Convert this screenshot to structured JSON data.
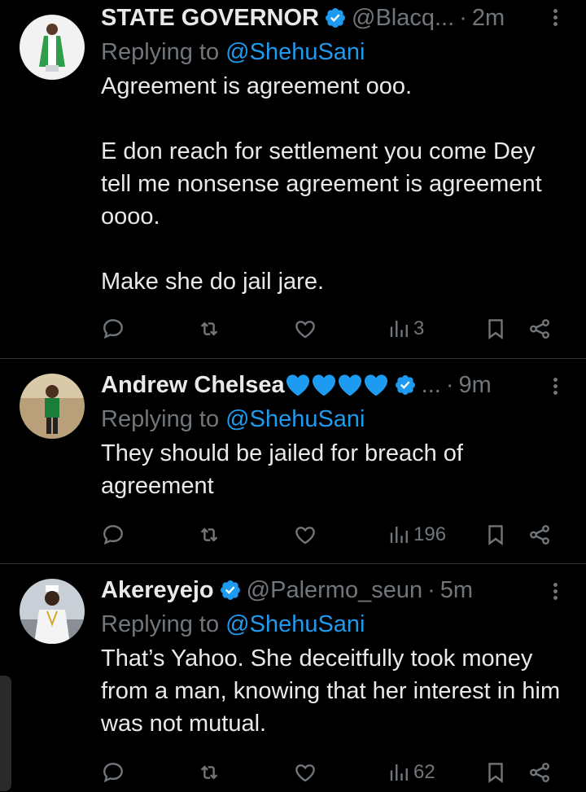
{
  "tweets": [
    {
      "name": "STATE GOVERNOR",
      "handle": "@Blacq...",
      "time": "2m",
      "replying_prefix": "Replying to ",
      "replying_to": "@ShehuSani",
      "text": "Agreement is agreement ooo.\n\nE don reach for settlement you come Dey tell me nonsense agreement is agreement oooo.\n\nMake she do jail jare.",
      "views": "3"
    },
    {
      "name": "Andrew Chelsea",
      "handle": "...",
      "time": "9m",
      "replying_prefix": "Replying to ",
      "replying_to": "@ShehuSani",
      "text": "They should be jailed for breach of agreement",
      "views": "196"
    },
    {
      "name": "Akereyejo",
      "handle": "@Palermo_seun",
      "time": "5m",
      "replying_prefix": "Replying to ",
      "replying_to": "@ShehuSani",
      "text": "That’s Yahoo. She deceitfully took money from a man, knowing that her interest in him was not mutual.",
      "views": "62"
    }
  ],
  "colors": {
    "background": "#000000",
    "text": "#e7e9ea",
    "muted": "#71767b",
    "accent": "#1d9bf0",
    "heart": "#1d9bf0",
    "divider": "#2f3336"
  },
  "icons": [
    "verified-badge-icon",
    "more-icon",
    "reply-icon",
    "retweet-icon",
    "like-icon",
    "views-icon",
    "bookmark-icon",
    "share-icon",
    "blue-heart-icon"
  ]
}
